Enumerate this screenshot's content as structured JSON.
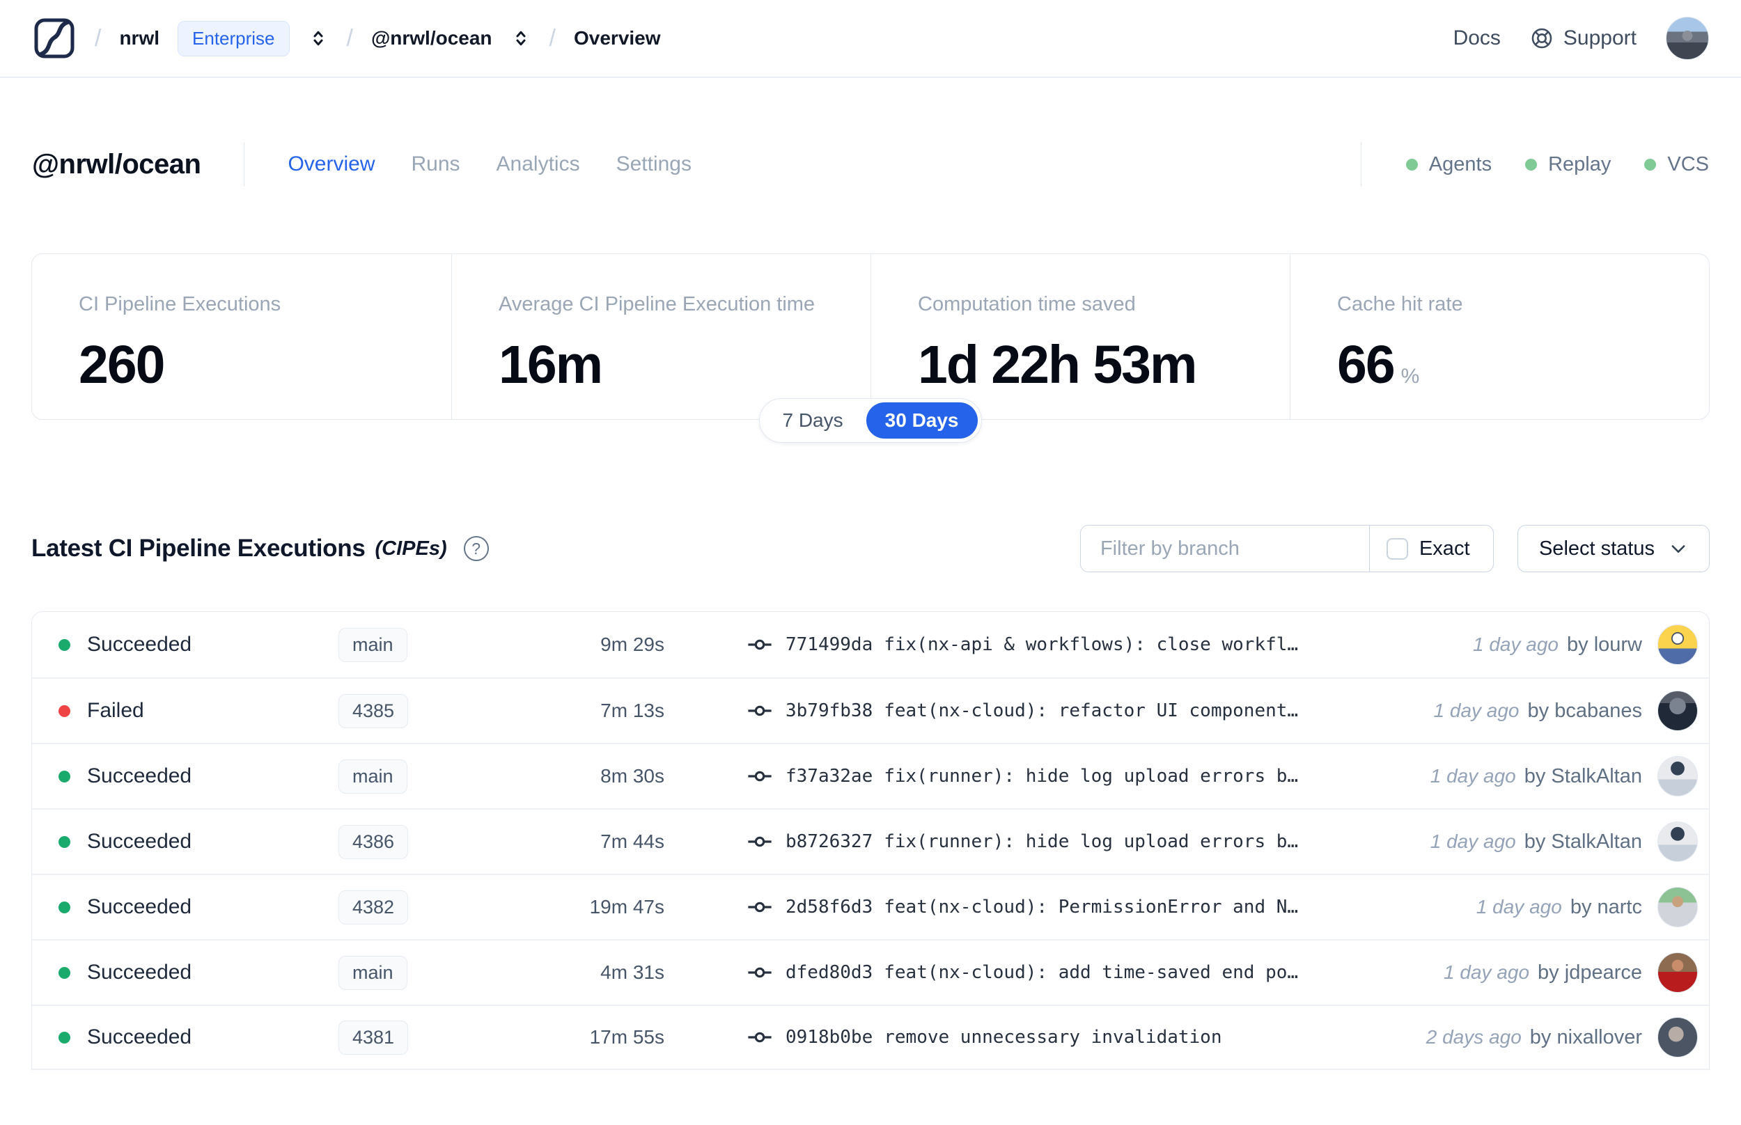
{
  "nav": {
    "breadcrumb": {
      "separator": "/",
      "org": "nrwl",
      "org_badge": "Enterprise",
      "workspace": "@nrwl/ocean",
      "page": "Overview"
    },
    "docs_label": "Docs",
    "support_label": "Support"
  },
  "header": {
    "title": "@nrwl/ocean",
    "tabs": [
      {
        "label": "Overview",
        "active": true
      },
      {
        "label": "Runs",
        "active": false
      },
      {
        "label": "Analytics",
        "active": false
      },
      {
        "label": "Settings",
        "active": false
      }
    ],
    "statuses": [
      {
        "label": "Agents"
      },
      {
        "label": "Replay"
      },
      {
        "label": "VCS"
      }
    ]
  },
  "stats": {
    "cards": [
      {
        "label": "CI Pipeline Executions",
        "value": "260",
        "suffix": ""
      },
      {
        "label": "Average CI Pipeline Execution time",
        "value": "16m",
        "suffix": ""
      },
      {
        "label": "Computation time saved",
        "value": "1d 22h 53m",
        "suffix": ""
      },
      {
        "label": "Cache hit rate",
        "value": "66",
        "suffix": "%"
      }
    ],
    "range_toggle": {
      "options": [
        "7 Days",
        "30 Days"
      ],
      "selected": "30 Days"
    }
  },
  "cipes": {
    "title": "Latest CI Pipeline Executions",
    "subtitle": "(CIPEs)",
    "help_glyph": "?",
    "filter_placeholder": "Filter by branch",
    "exact_label": "Exact",
    "status_button": "Select status",
    "by_label": "by",
    "rows": [
      {
        "status": "Succeeded",
        "branch": "main",
        "duration": "9m 29s",
        "hash": "771499da",
        "message": "fix(nx-api & workflows): close workfl…",
        "time": "1 day ago",
        "author": "lourw",
        "avatar": "minion"
      },
      {
        "status": "Failed",
        "branch": "4385",
        "duration": "7m 13s",
        "hash": "3b79fb38",
        "message": "feat(nx-cloud): refactor UI component…",
        "time": "1 day ago",
        "author": "bcabanes",
        "avatar": "dark"
      },
      {
        "status": "Succeeded",
        "branch": "main",
        "duration": "8m 30s",
        "hash": "f37a32ae",
        "message": "fix(runner): hide log upload errors b…",
        "time": "1 day ago",
        "author": "StalkAltan",
        "avatar": "light"
      },
      {
        "status": "Succeeded",
        "branch": "4386",
        "duration": "7m 44s",
        "hash": "b8726327",
        "message": "fix(runner): hide log upload errors b…",
        "time": "1 day ago",
        "author": "StalkAltan",
        "avatar": "light"
      },
      {
        "status": "Succeeded",
        "branch": "4382",
        "duration": "19m 47s",
        "hash": "2d58f6d3",
        "message": "feat(nx-cloud): PermissionError and N…",
        "time": "1 day ago",
        "author": "nartc",
        "avatar": "green"
      },
      {
        "status": "Succeeded",
        "branch": "main",
        "duration": "4m 31s",
        "hash": "dfed80d3",
        "message": "feat(nx-cloud): add time-saved end po…",
        "time": "1 day ago",
        "author": "jdpearce",
        "avatar": "red"
      },
      {
        "status": "Succeeded",
        "branch": "4381",
        "duration": "17m 55s",
        "hash": "0918b0be",
        "message": "remove unnecessary invalidation",
        "time": "2 days ago",
        "author": "nixallover",
        "avatar": "gray"
      }
    ]
  },
  "colors": {
    "accent_blue": "#2563eb",
    "succeeded_green": "#1aaa6c",
    "failed_red": "#ef4444",
    "indicator_green": "#80ca96",
    "border": "#e4e9f0",
    "muted_text": "#9aa6b6"
  }
}
